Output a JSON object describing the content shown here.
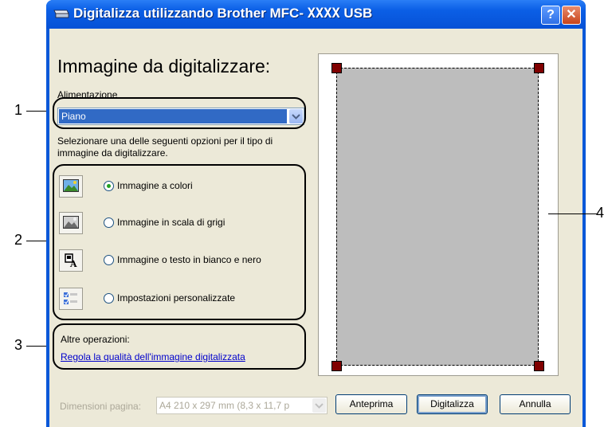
{
  "window": {
    "title_prefix": "Digitalizza utilizzando Brother MFC-",
    "title_model": "XXXX",
    "title_suffix": "USB",
    "help_label": "?",
    "close_label": "✕"
  },
  "heading": "Immagine da digitalizzare:",
  "source": {
    "label": "Alimentazione",
    "selected": "Piano"
  },
  "instructions": "Selezionare una delle seguenti opzioni per il tipo di immagine da digitalizzare.",
  "options": [
    {
      "label": "Immagine a colori",
      "icon": "color-photo-icon",
      "selected": true
    },
    {
      "label": "Immagine in scala di grigi",
      "icon": "grayscale-photo-icon",
      "selected": false
    },
    {
      "label": "Immagine o testo in bianco e nero",
      "icon": "bw-text-icon",
      "selected": false
    },
    {
      "label": "Impostazioni personalizzate",
      "icon": "custom-settings-icon",
      "selected": false
    }
  ],
  "other_ops": {
    "label": "Altre operazioni:",
    "link": "Regola la qualità dell'immagine digitalizzata"
  },
  "page_size": {
    "label": "Dimensioni pagina:",
    "value": "A4 210 x 297 mm (8,3 x 11,7 p"
  },
  "buttons": {
    "preview": "Anteprima",
    "scan": "Digitalizza",
    "cancel": "Annulla"
  },
  "callouts": [
    "1",
    "2",
    "3",
    "4"
  ],
  "colors": {
    "title_bar": "#0651d6",
    "selection": "#316ac5",
    "preview_area": "#bdbdbd",
    "crop_handle": "#800000",
    "link": "#0000cc"
  }
}
